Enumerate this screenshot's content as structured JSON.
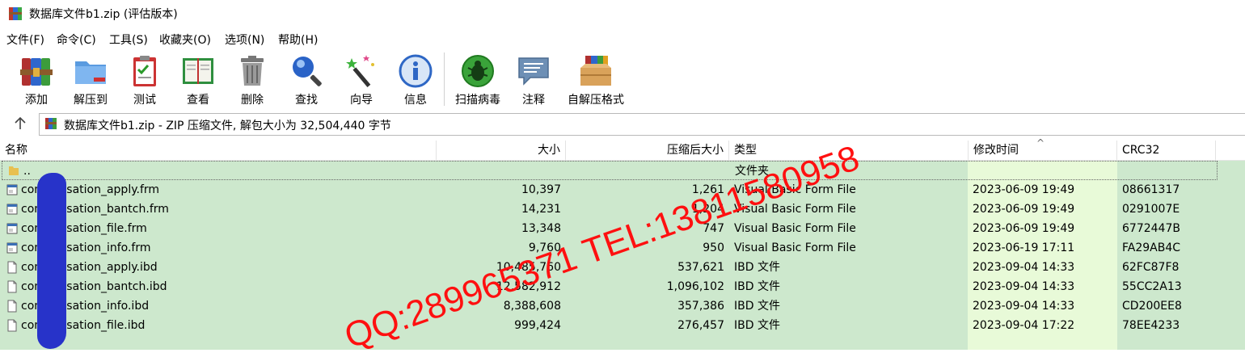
{
  "window": {
    "title": "数据库文件b1.zip (评估版本)"
  },
  "menu": [
    "文件(F)",
    "命令(C)",
    "工具(S)",
    "收藏夹(O)",
    "选项(N)",
    "帮助(H)"
  ],
  "toolbar": [
    {
      "label": "添加",
      "icon": "add-archive-icon"
    },
    {
      "label": "解压到",
      "icon": "extract-to-folder-icon"
    },
    {
      "label": "测试",
      "icon": "test-clipboard-icon"
    },
    {
      "label": "查看",
      "icon": "view-book-icon"
    },
    {
      "label": "删除",
      "icon": "trash-icon"
    },
    {
      "label": "查找",
      "icon": "magnifier-icon"
    },
    {
      "label": "向导",
      "icon": "wizard-wand-icon"
    },
    {
      "label": "信息",
      "icon": "info-icon"
    },
    {
      "label": "扫描病毒",
      "icon": "virus-scan-icon"
    },
    {
      "label": "注释",
      "icon": "comment-icon"
    },
    {
      "label": "自解压格式",
      "icon": "sfx-box-icon"
    }
  ],
  "address": {
    "text": "数据库文件b1.zip - ZIP 压缩文件, 解包大小为 32,504,440 字节"
  },
  "columns": {
    "name": "名称",
    "size": "大小",
    "packed": "压缩后大小",
    "type": "类型",
    "modified": "修改时间",
    "crc": "CRC32"
  },
  "parent_row": {
    "name": "..",
    "type": "文件夹"
  },
  "files": [
    {
      "name": "compensation_apply.frm",
      "size": "10,397",
      "packed": "1,261",
      "type": "Visual Basic Form File",
      "modified": "2023-06-09 19:49",
      "crc": "08661317",
      "kind": "frm"
    },
    {
      "name": "compensation_bantch.frm",
      "size": "14,231",
      "packed": "1,204",
      "type": "Visual Basic Form File",
      "modified": "2023-06-09 19:49",
      "crc": "0291007E",
      "kind": "frm"
    },
    {
      "name": "compensation_file.frm",
      "size": "13,348",
      "packed": "747",
      "type": "Visual Basic Form File",
      "modified": "2023-06-09 19:49",
      "crc": "6772447B",
      "kind": "frm"
    },
    {
      "name": "compensation_info.frm",
      "size": "9,760",
      "packed": "950",
      "type": "Visual Basic Form File",
      "modified": "2023-06-19 17:11",
      "crc": "FA29AB4C",
      "kind": "frm"
    },
    {
      "name": "compensation_apply.ibd",
      "size": "10,485,760",
      "packed": "537,621",
      "type": "IBD 文件",
      "modified": "2023-09-04 14:33",
      "crc": "62FC87F8",
      "kind": "ibd"
    },
    {
      "name": "compensation_bantch.ibd",
      "size": "12,582,912",
      "packed": "1,096,102",
      "type": "IBD 文件",
      "modified": "2023-09-04 14:33",
      "crc": "55CC2A13",
      "kind": "ibd"
    },
    {
      "name": "compensation_info.ibd",
      "size": "8,388,608",
      "packed": "357,386",
      "type": "IBD 文件",
      "modified": "2023-09-04 14:33",
      "crc": "CD200EE8",
      "kind": "ibd"
    },
    {
      "name": "compensation_file.ibd",
      "size": "999,424",
      "packed": "276,457",
      "type": "IBD 文件",
      "modified": "2023-09-04 17:22",
      "crc": "78EE4233",
      "kind": "ibd"
    }
  ],
  "watermark": "QQ:289965371 TEL:13811580958",
  "colors": {
    "list_bg": "#cde8cd",
    "date_highlight": "#e8fad8",
    "watermark": "#ff1010",
    "redaction": "#2733c9"
  }
}
